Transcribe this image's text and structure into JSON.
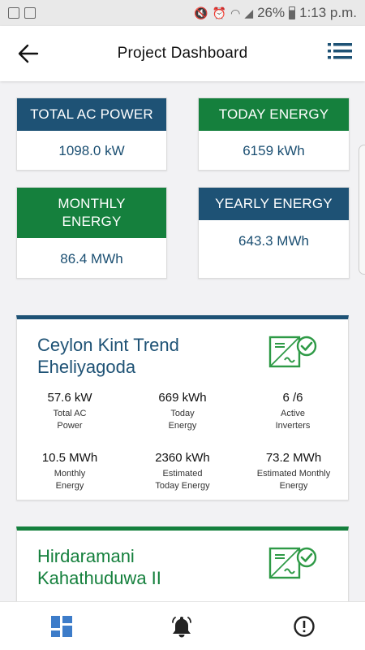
{
  "status_bar": {
    "battery": "26%",
    "time": "1:13 p.m."
  },
  "header": {
    "title": "Project Dashboard"
  },
  "summary": {
    "total_ac_power": {
      "label": "TOTAL AC POWER",
      "value": "1098.0 kW"
    },
    "today_energy": {
      "label": "TODAY ENERGY",
      "value": "6159 kWh"
    },
    "monthly_energy": {
      "label": "MONTHLY ENERGY",
      "value": "86.4 MWh"
    },
    "yearly_energy": {
      "label": "YEARLY ENERGY",
      "value": "643.3 MWh"
    }
  },
  "sites": [
    {
      "name": "Ceylon Kint Trend Eheliyagoda",
      "accent": "#1e5275",
      "metrics": [
        {
          "value": "57.6 kW",
          "label": "Total AC Power"
        },
        {
          "value": "669 kWh",
          "label": "Today Energy"
        },
        {
          "value": "6 /6",
          "label": "Active Inverters"
        },
        {
          "value": "10.5 MWh",
          "label": "Monthly Energy"
        },
        {
          "value": "2360 kWh",
          "label": "Estimated Today Energy"
        },
        {
          "value": "73.2 MWh",
          "label": "Estimated Monthly Energy"
        }
      ]
    },
    {
      "name": "Hirdaramani Kahathuduwa II",
      "accent": "#15803d"
    }
  ],
  "colors": {
    "blue": "#1e5275",
    "green": "#15803d",
    "nav_active": "#3d7cc9"
  },
  "icons": {
    "back": "arrow-left-icon",
    "menu": "list-menu-icon",
    "site_status": "inverter-ok-icon",
    "nav_dashboard": "dashboard-grid-icon",
    "nav_alerts": "bell-icon",
    "nav_info": "alert-circle-icon"
  }
}
